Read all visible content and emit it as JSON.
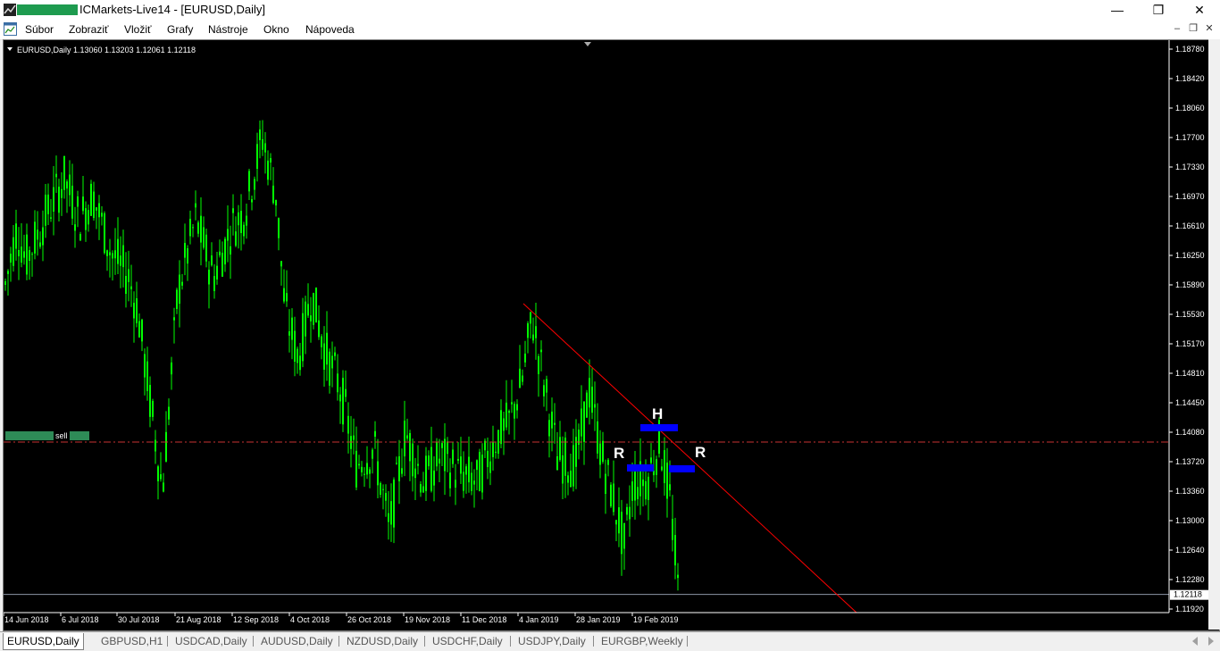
{
  "window": {
    "title": "ICMarkets-Live14 - [EURUSD,Daily]",
    "minimize_glyph": "—",
    "maximize_glyph": "❐",
    "close_glyph": "✕"
  },
  "menu": {
    "items": [
      "Súbor",
      "Zobraziť",
      "Vložiť",
      "Grafy",
      "Nástroje",
      "Okno",
      "Nápoveda"
    ],
    "mdi": [
      "–",
      "❐",
      "✕"
    ]
  },
  "chart": {
    "header": "EURUSD,Daily  1.13060 1.13203 1.12061 1.12118",
    "current_price": "1.12118",
    "sell_label": "sell",
    "annotations": [
      "H",
      "R",
      "R"
    ],
    "colors": {
      "background": "#000000",
      "candles": "#00ff00",
      "trendline": "#ff0000",
      "sell_line": "#c83232",
      "markers": "#0000ff",
      "sell_box": "#2e8b57"
    }
  },
  "chart_data": {
    "type": "candlestick",
    "symbol": "EURUSD",
    "timeframe": "Daily",
    "ohlc_last": {
      "open": 1.1306,
      "high": 1.13203,
      "low": 1.12061,
      "close": 1.12118
    },
    "y_ticks": [
      "1.18780",
      "1.18420",
      "1.18060",
      "1.17700",
      "1.17330",
      "1.16970",
      "1.16610",
      "1.16250",
      "1.15890",
      "1.15530",
      "1.15170",
      "1.14810",
      "1.14450",
      "1.14080",
      "1.13720",
      "1.13360",
      "1.13000",
      "1.12640",
      "1.12280",
      "1.11920"
    ],
    "x_ticks": [
      "14 Jun 2018",
      "6 Jul 2018",
      "30 Jul 2018",
      "21 Aug 2018",
      "12 Sep 2018",
      "4 Oct 2018",
      "26 Oct 2018",
      "19 Nov 2018",
      "11 Dec 2018",
      "4 Jan 2019",
      "28 Jan 2019",
      "19 Feb 2019"
    ],
    "ylim": [
      1.1192,
      1.1878
    ],
    "sell_level": 1.1398,
    "bid_line": 1.12118,
    "trendline": [
      {
        "date": "4 Jan 2019",
        "price": 1.1568
      },
      {
        "date": "after 19 Feb 2019",
        "price": 1.1192
      }
    ]
  },
  "tabs": [
    "EURUSD,Daily",
    "GBPUSD,H1",
    "USDCAD,Daily",
    "AUDUSD,Daily",
    "NZDUSD,Daily",
    "USDCHF,Daily",
    "USDJPY,Daily",
    "EURGBP,Weekly"
  ]
}
